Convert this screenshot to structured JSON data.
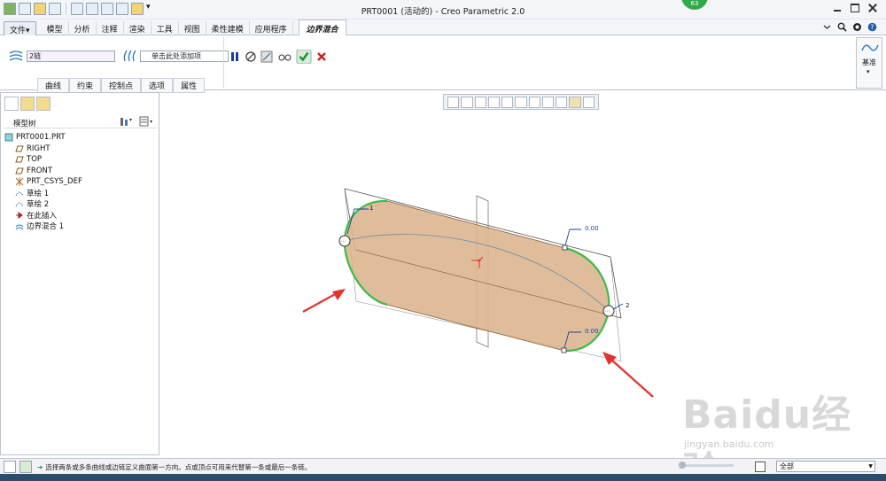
{
  "window": {
    "title": "PRT0001 (活动的) - Creo Parametric 2.0",
    "badge": "63"
  },
  "menu": {
    "file": "文件▾",
    "tabs": [
      "模型",
      "分析",
      "注释",
      "渲染",
      "工具",
      "视图",
      "柔性建模",
      "应用程序"
    ],
    "active_tab": "边界混合"
  },
  "ribbon": {
    "first_direction_value": "2链",
    "second_direction_placeholder": "单击此处添加项",
    "sub_tabs": [
      "曲线",
      "约束",
      "控制点",
      "选项",
      "属性"
    ],
    "datum_label": "基准"
  },
  "model_tree": {
    "title": "模型树",
    "items": [
      {
        "label": "PRT0001.PRT",
        "icon": "part-icon"
      },
      {
        "label": "RIGHT",
        "icon": "datum-plane-icon"
      },
      {
        "label": "TOP",
        "icon": "datum-plane-icon"
      },
      {
        "label": "FRONT",
        "icon": "datum-plane-icon"
      },
      {
        "label": "PRT_CSYS_DEF",
        "icon": "csys-icon"
      },
      {
        "label": "草绘 1",
        "icon": "sketch-icon"
      },
      {
        "label": "草绘 2",
        "icon": "sketch-icon"
      },
      {
        "label": "在此插入",
        "icon": "insert-arrow-icon"
      },
      {
        "label": "边界混合 1",
        "icon": "boundary-blend-icon"
      }
    ]
  },
  "canvas": {
    "dim_label_1": "0.00",
    "dim_label_2": "0.00",
    "chain_label_1": "1",
    "chain_label_2": "2",
    "accent_surface": "#dcb48c",
    "accent_edge": "#3dbb48",
    "accent_arrow": "#e2332e"
  },
  "status": {
    "message": "选择两条或多条曲线或边链定义曲面第一方向。点或顶点可用来代替第一条或最后一条链。",
    "filter": "全部"
  },
  "watermark": {
    "logo": "Baidu经验",
    "sub": "jingyan.baidu.com"
  }
}
